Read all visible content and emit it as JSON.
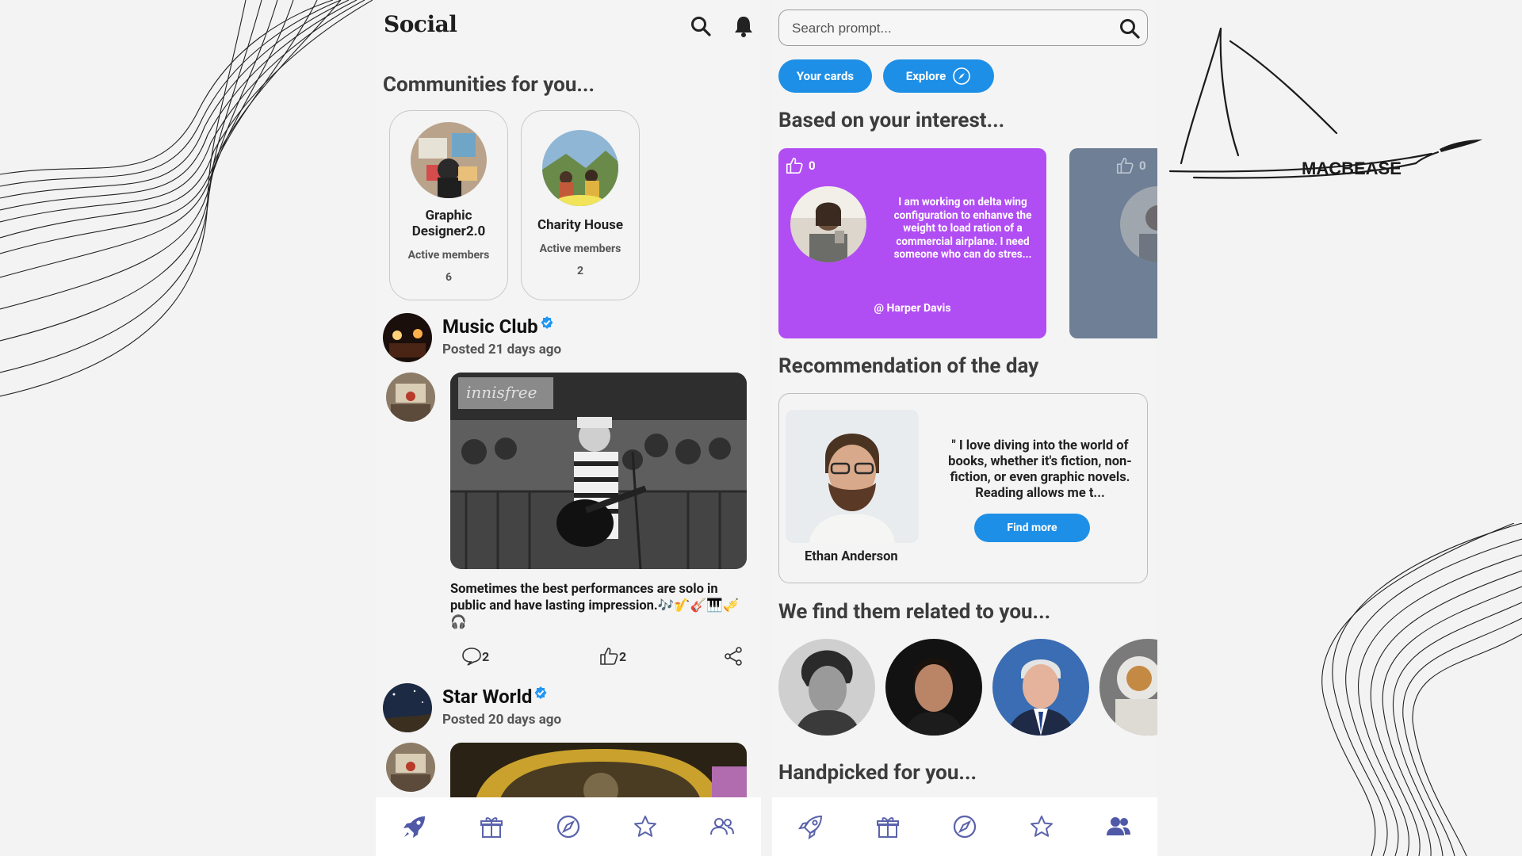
{
  "left": {
    "brand": "Social",
    "communities_title": "Communities for you...",
    "communities": [
      {
        "name": "Graphic Designer2.0",
        "sub": "Active members",
        "count": "6"
      },
      {
        "name": "Charity House",
        "sub": "Active members",
        "count": "2"
      }
    ],
    "posts": [
      {
        "title": "Music Club",
        "time": "Posted 21 days ago",
        "caption": "Sometimes the best performances are solo in public and have lasting impression.🎶🎷🎸🎹🎺🎧",
        "comments": "2",
        "likes": "2"
      },
      {
        "title": "Star World",
        "time": "Posted 20 days ago"
      }
    ]
  },
  "right": {
    "search_placeholder": "Search prompt...",
    "your_cards_label": "Your cards",
    "explore_label": "Explore",
    "interest_title": "Based on your interest...",
    "interest_cards": [
      {
        "likes": "0",
        "text": "I am working on delta wing configuration to enhanve the weight to load ration of a commercial airplane. I need someone who can do stres...",
        "handle": "@ Harper Davis",
        "color": "#b14ef3"
      },
      {
        "likes": "0",
        "color": "#6e7f96"
      }
    ],
    "recommendation_title": "Recommendation of the day",
    "recommendation": {
      "quote": "\" I love diving into the world of books, whether it's fiction, non-fiction, or even graphic novels. Reading allows me t...",
      "button": "Find more",
      "name": "Ethan Anderson"
    },
    "related_title": "We find them related to you...",
    "handpicked_title": "Handpicked for you..."
  },
  "logo_text": "MACBEASE",
  "colors": {
    "accent": "#1e8fe6",
    "nav_active": "#4f59a8",
    "nav_inactive": "#5b63ab",
    "card_purple": "#b14ef3"
  },
  "nav_icons": [
    "rocket-icon",
    "gift-icon",
    "compass-icon",
    "star-icon",
    "people-icon"
  ]
}
